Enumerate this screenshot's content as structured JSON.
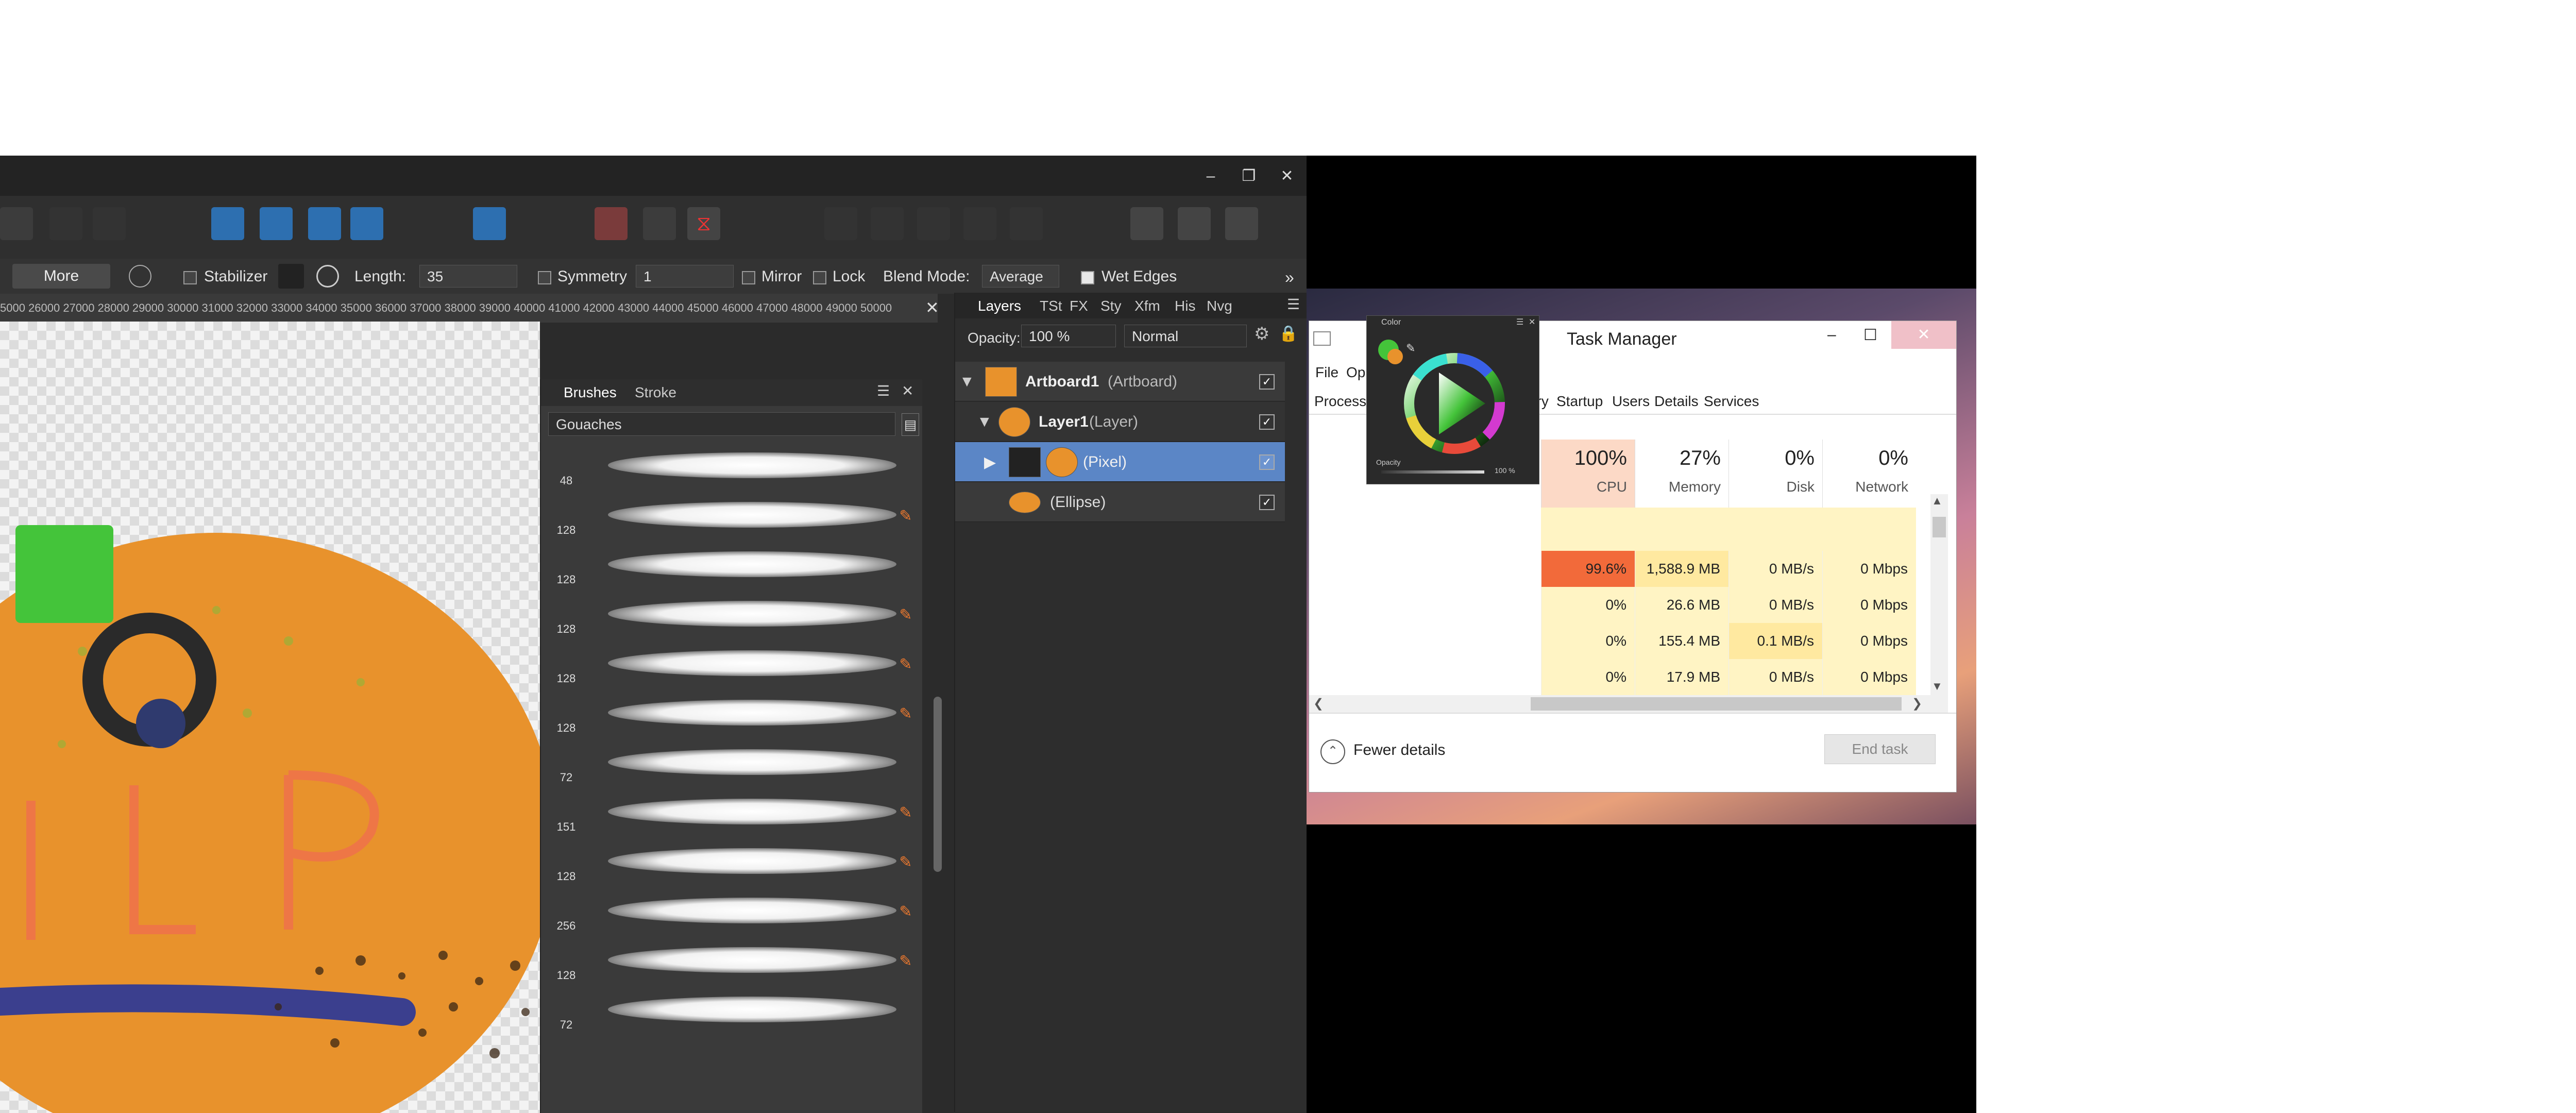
{
  "affinity": {
    "toolbar": {
      "more_label": "More"
    },
    "context": {
      "stabilizer_label": "Stabilizer",
      "length_label": "Length:",
      "length_value": "35",
      "symmetry_label": "Symmetry",
      "symmetry_value": "1",
      "mirror_label": "Mirror",
      "lock_label": "Lock",
      "blend_mode_label": "Blend Mode:",
      "blend_mode_value": "Average",
      "wet_edges_label": "Wet Edges"
    },
    "ruler_text": "5000  26000  27000  28000  29000  30000  31000  32000  33000  34000  35000  36000  37000  38000  39000  40000  41000  42000  43000  44000  45000  46000  47000  48000  49000  50000",
    "brushes_panel": {
      "tabs": [
        "Brushes",
        "Stroke"
      ],
      "category": "Gouaches",
      "sizes": [
        "48",
        "128",
        "128",
        "128",
        "128",
        "128",
        "72",
        "151",
        "128",
        "256",
        "128",
        "72"
      ]
    },
    "layers_panel": {
      "tabs": [
        "Layers",
        "TSt",
        "FX",
        "Sty",
        "Xfm",
        "His",
        "Nvg"
      ],
      "opacity_label": "Opacity:",
      "opacity_value": "100 %",
      "blend_value": "Normal",
      "rows": [
        {
          "name": "Artboard1",
          "type": "(Artboard)"
        },
        {
          "name": "Layer1",
          "type": "(Layer)"
        },
        {
          "name": "",
          "type": "(Pixel)"
        },
        {
          "name": "",
          "type": "(Ellipse)"
        }
      ]
    }
  },
  "task_manager": {
    "title": "Task Manager",
    "menu": [
      "File",
      "Op"
    ],
    "tabs": [
      "Process",
      "ory",
      "Startup",
      "Users",
      "Details",
      "Services"
    ],
    "columns": [
      {
        "pct": "100%",
        "name": "CPU"
      },
      {
        "pct": "27%",
        "name": "Memory"
      },
      {
        "pct": "0%",
        "name": "Disk"
      },
      {
        "pct": "0%",
        "name": "Network"
      }
    ],
    "rows": [
      [
        "99.6%",
        "1,588.9 MB",
        "0 MB/s",
        "0 Mbps"
      ],
      [
        "0%",
        "26.6 MB",
        "0 MB/s",
        "0 Mbps"
      ],
      [
        "0%",
        "155.4 MB",
        "0.1 MB/s",
        "0 Mbps"
      ],
      [
        "0%",
        "17.9 MB",
        "0 MB/s",
        "0 Mbps"
      ]
    ],
    "fewer_details": "Fewer details",
    "end_task": "End task"
  },
  "color_panel": {
    "title": "Color",
    "opacity_label": "Opacity",
    "opacity_value": "100 %"
  },
  "colors": {
    "selection": "#5b86c6",
    "cpu_hot": "#f26a3a",
    "cpu_header": "#fcd9c6",
    "cell_yellow": "#fff4c4",
    "cell_yellow_strong": "#ffe9a0",
    "pumpkin": "#e8922c"
  }
}
